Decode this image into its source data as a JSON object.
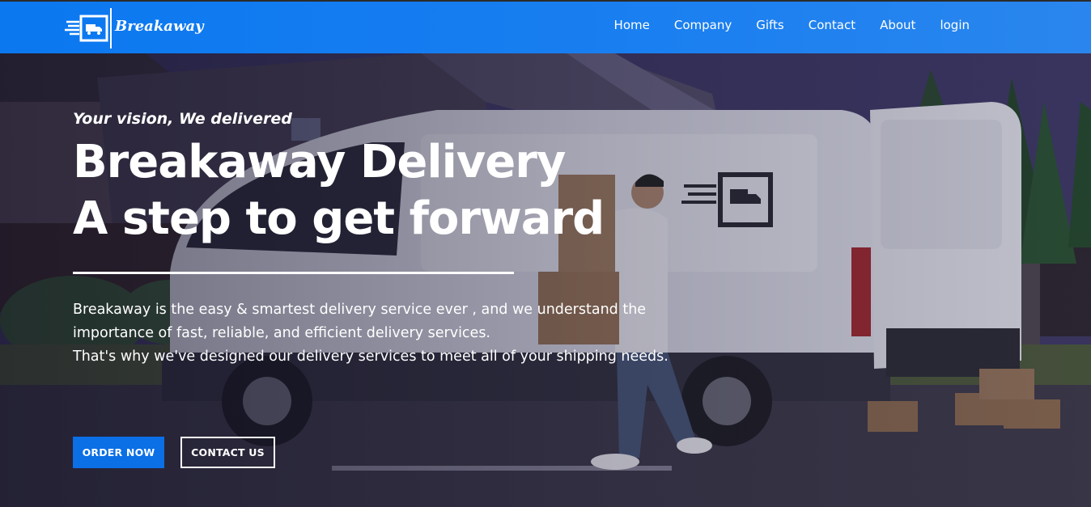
{
  "brand": {
    "name": "Breakaway"
  },
  "nav": {
    "items": [
      "Home",
      "Company",
      "Gifts",
      "Contact",
      "About",
      "login"
    ]
  },
  "hero": {
    "tagline": "Your vision, We delivered",
    "headline_line1": "Breakaway Delivery",
    "headline_line2": "A step to get forward",
    "description_1": "Breakaway is the easy & smartest delivery service ever , and we understand the importance of fast, reliable, and efficient delivery services.",
    "description_2": "That's why we've designed our delivery services to meet all of your shipping needs.",
    "order_button": "ORDER NOW",
    "contact_button": "CONTACT US"
  },
  "colors": {
    "navbar": "#0b78f0",
    "primary_button": "#0b6fe6",
    "text": "#ffffff"
  }
}
